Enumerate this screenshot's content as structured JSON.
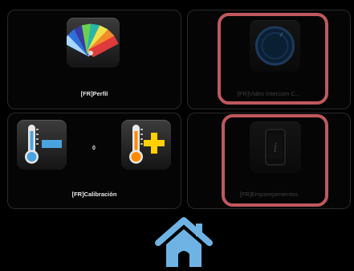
{
  "tiles": {
    "profile": {
      "label": "[FR]Perfil",
      "icon": "color-palette-icon"
    },
    "intercom": {
      "label": "[FR]Video Intercom C...",
      "icon": "intercom-knob-icon",
      "disabled": true,
      "highlighted": true
    },
    "calibration": {
      "label": "[FR]Calibración",
      "value": "0",
      "decrease_icon": "thermometer-minus-icon",
      "increase_icon": "thermometer-plus-icon"
    },
    "pairing": {
      "label": "[FR]Emparejamientos",
      "icon": "phone-info-icon",
      "disabled": true,
      "highlighted": true
    }
  },
  "home": {
    "icon": "home-icon"
  },
  "colors": {
    "background": "#000000",
    "highlight": "#c0585d",
    "home": "#6fb3e4",
    "thermo_blue": "#4aa3df",
    "thermo_orange": "#ff8a00",
    "plus_yellow": "#ffd000"
  }
}
